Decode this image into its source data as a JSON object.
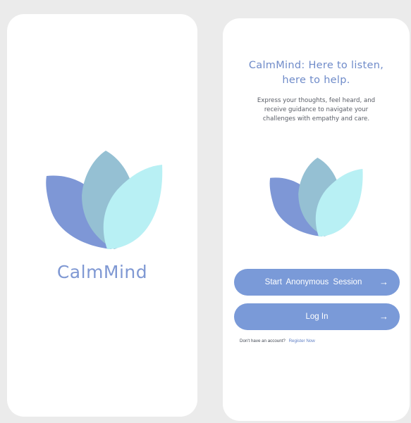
{
  "splash": {
    "app_name": "CalmMind",
    "logo_icon": "lotus-petals-icon"
  },
  "welcome": {
    "title_line1": "CalmMind: Here to listen,",
    "title_line2": "here to help.",
    "subtitle_line1": "Express your thoughts, feel heard, and",
    "subtitle_line2": "receive guidance to navigate your",
    "subtitle_line3": "challenges with empathy and care.",
    "logo_icon": "lotus-petals-icon",
    "anon_button_label": "Start  Anonymous Session",
    "login_button_label": "Log In",
    "arrow_glyph": "→",
    "no_account_text": "Don't have an account?",
    "register_link_text": "Register Now"
  },
  "colors": {
    "background": "#ebebeb",
    "card": "#ffffff",
    "brand_text": "#7f98d3",
    "button": "#7a9ad8",
    "petal_dark": "#7e97d6",
    "petal_mid": "#95c0d3",
    "petal_light": "#b8f0f4"
  }
}
